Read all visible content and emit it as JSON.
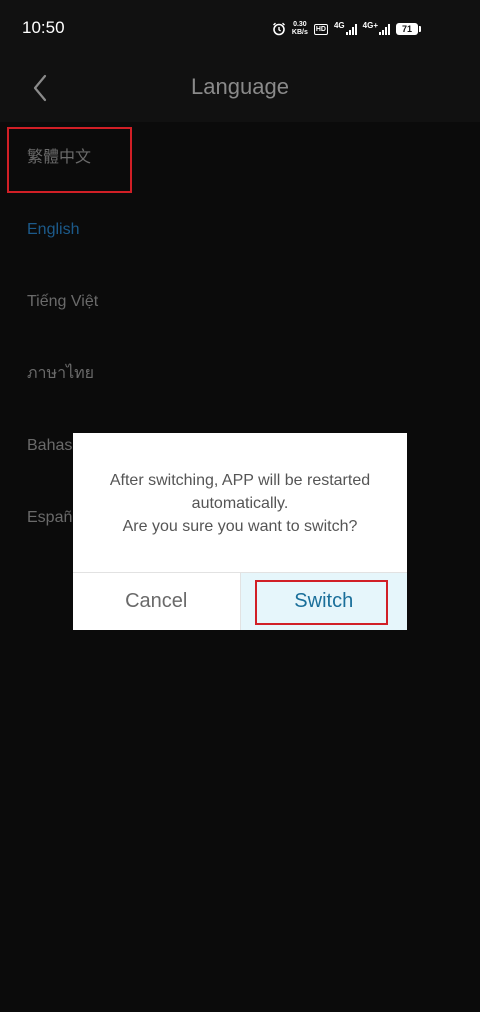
{
  "status_bar": {
    "time": "10:50",
    "net_speed_value": "0.30",
    "net_speed_unit": "KB/s",
    "hd_label": "HD",
    "sim1_label": "4G",
    "sim2_label": "4G+",
    "battery_level": "71"
  },
  "header": {
    "title": "Language"
  },
  "languages": [
    {
      "label": "繁體中文"
    },
    {
      "label": "English"
    },
    {
      "label": "Tiếng Việt"
    },
    {
      "label": "ภาษาไทย"
    },
    {
      "label": "Bahasa Indonesia"
    },
    {
      "label": "Español"
    }
  ],
  "dialog": {
    "message_line1": "After switching, APP will be restarted",
    "message_line2": "automatically.",
    "message_line3": "Are you sure you want to switch?",
    "cancel_label": "Cancel",
    "confirm_label": "Switch"
  },
  "colors": {
    "selected_language": "#1c5a8a",
    "annotation_highlight": "#d11f26",
    "switch_text": "#1a6f9a",
    "switch_bg": "#e6f6fb"
  }
}
